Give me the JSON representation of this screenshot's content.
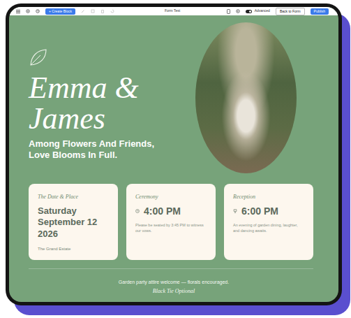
{
  "toolbar": {
    "create_button": "+ Create Block",
    "title": "Form Test",
    "advanced": {
      "label": "Advanced",
      "on": true
    },
    "back_button": "Back to Form",
    "publish_button": "Publish"
  },
  "hero": {
    "names": "Emma & James",
    "tagline": "Among Flowers And Friends, Love Blooms In Full."
  },
  "cards": [
    {
      "kind": "date",
      "title": "The Date & Place",
      "value": "Saturday September 12 2026",
      "note": "The Grand Estate"
    },
    {
      "kind": "clock",
      "title": "Ceremony",
      "value": "4:00 PM",
      "note": "Please be seated by 3:45 PM to witness our vows."
    },
    {
      "kind": "glass",
      "title": "Reception",
      "value": "6:00 PM",
      "note": "An evening of garden dining, laughter, and dancing awaits."
    }
  ],
  "footer": {
    "attire": "Garden party attire welcome — florals encouraged.",
    "dress_code": "Black Tie Optional"
  }
}
